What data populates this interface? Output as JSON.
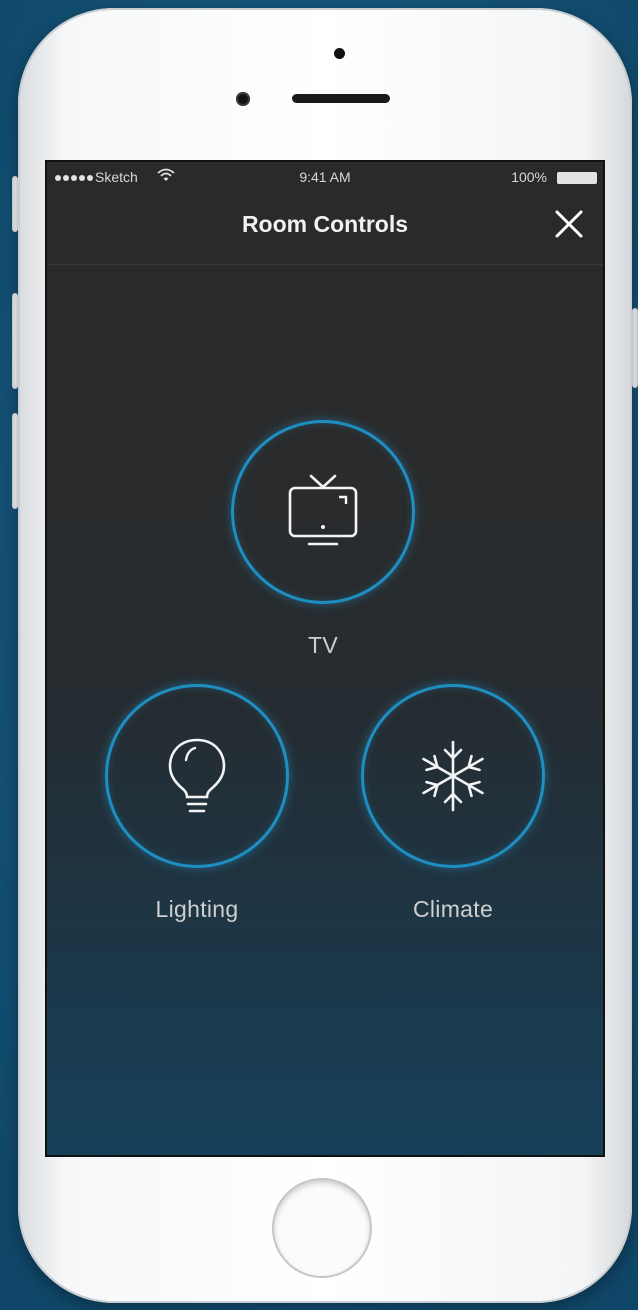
{
  "status_bar": {
    "carrier": "Sketch",
    "time": "9:41 AM",
    "battery": "100%"
  },
  "nav": {
    "title": "Room Controls",
    "close_icon": "close-icon"
  },
  "controls": [
    {
      "label": "TV",
      "icon": "tv-icon"
    },
    {
      "label": "Lighting",
      "icon": "lightbulb-icon"
    },
    {
      "label": "Climate",
      "icon": "snowflake-icon"
    }
  ],
  "colors": {
    "accent": "#1e8fc2",
    "screen_top": "#2a2a2b",
    "screen_bottom": "#16405a",
    "background": "#15577d"
  }
}
